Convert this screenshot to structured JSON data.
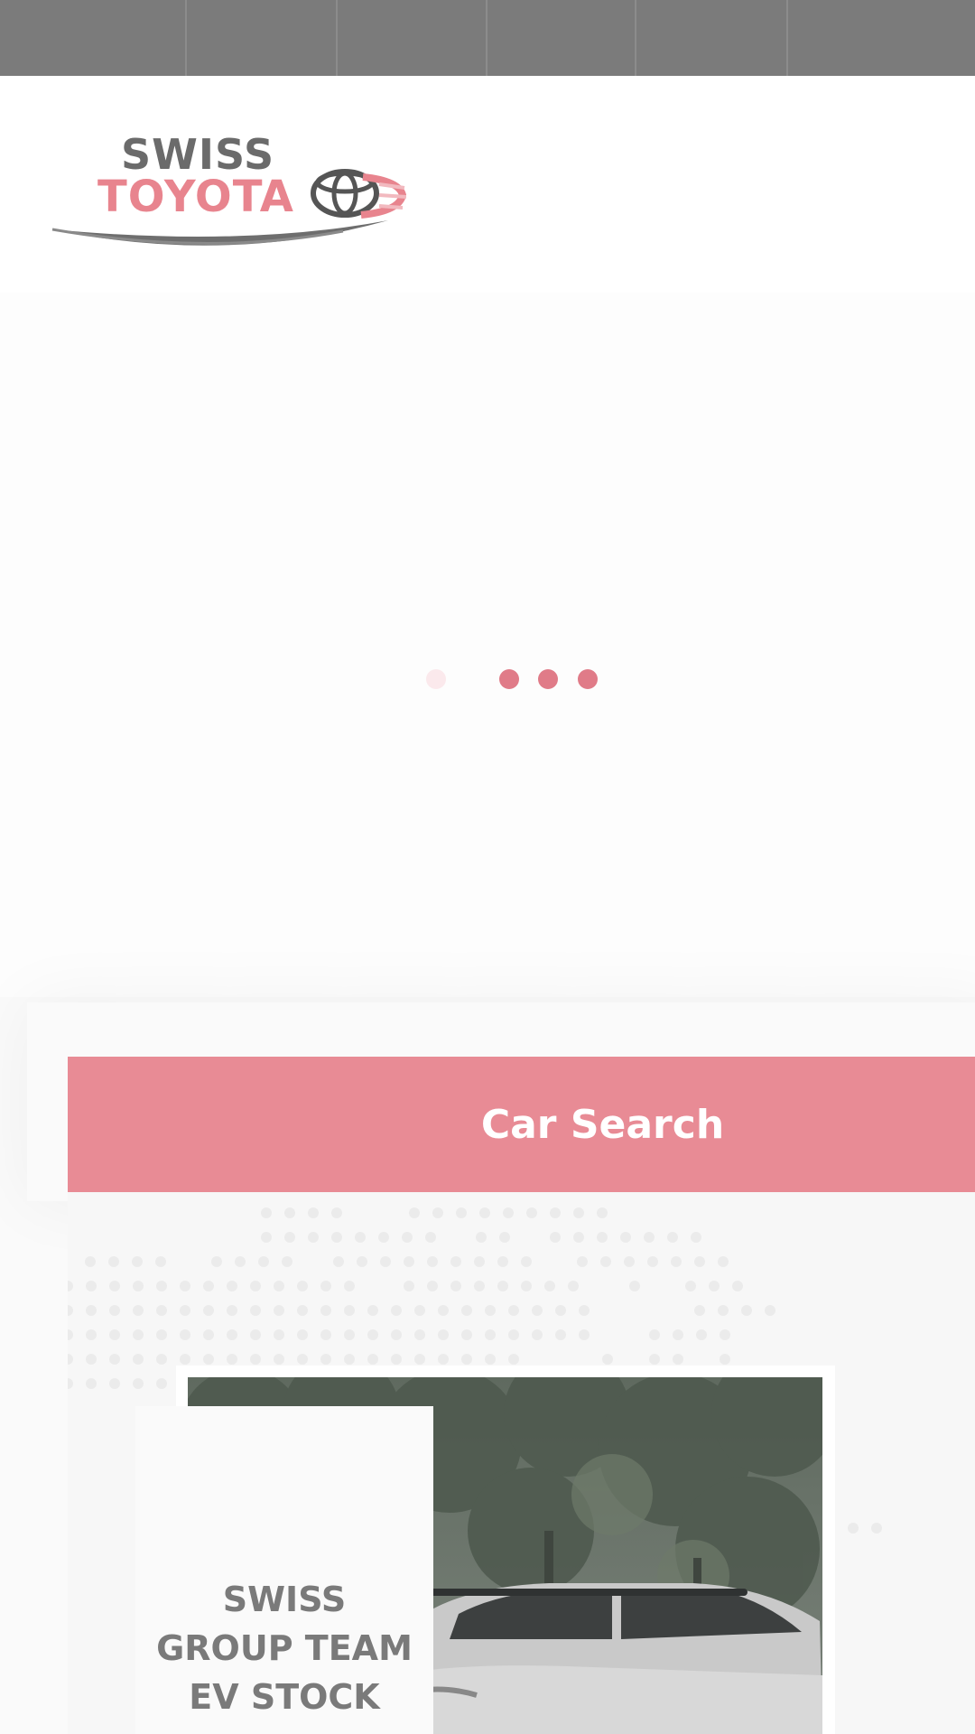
{
  "logo": {
    "line1": "SWISS",
    "line2": "TOYOTA",
    "brand_icon": "toyota-emblem-icon"
  },
  "loader": {
    "icon": "loading-dots-icon"
  },
  "car_search": {
    "label": "Car Search"
  },
  "stock_card": {
    "title_lines": [
      "SWISS",
      "GROUP TEAM",
      "EV STOCK"
    ],
    "badge_icon": "green-badge-icon",
    "photo_subject": "white-suv-photo"
  },
  "colors": {
    "nav_gray": "#7b7b7b",
    "accent_pink": "#e88b95",
    "logo_red": "#e8848e",
    "logo_gray": "#6b6b6b",
    "loader_dot": "#e07b88"
  }
}
